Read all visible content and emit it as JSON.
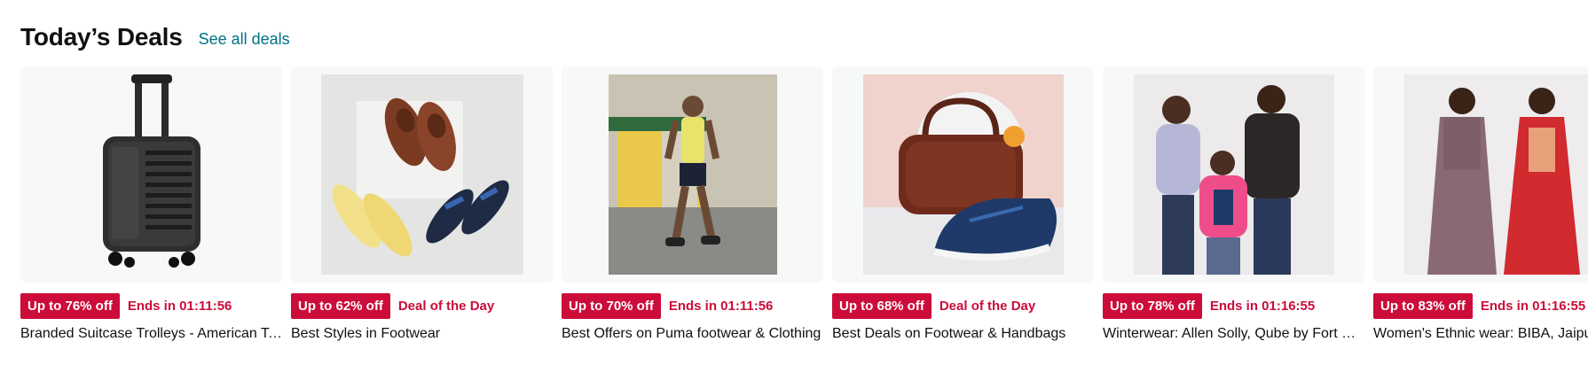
{
  "section": {
    "title": "Today’s Deals",
    "see_all_label": "See all deals"
  },
  "deals": [
    {
      "discount": "Up to 76% off",
      "status": "Ends in 01:11:56",
      "caption": "Branded Suitcase Trolleys - American Tourister, Safari, VIP & more",
      "image": "black-suitcase-trolley-icon"
    },
    {
      "discount": "Up to 62% off",
      "status": "Deal of the Day",
      "caption": "Best Styles in Footwear",
      "image": "footwear-shoes-sandals-icon"
    },
    {
      "discount": "Up to 70% off",
      "status": "Ends in 01:11:56",
      "caption": "Best Offers on Puma footwear & Clothing",
      "image": "athlete-walking-photo-icon"
    },
    {
      "discount": "Up to 68% off",
      "status": "Deal of the Day",
      "caption": "Best Deals on Footwear & Handbags",
      "image": "handbag-and-sneaker-icon"
    },
    {
      "discount": "Up to 78% off",
      "status": "Ends in 01:16:55",
      "caption": "Winterwear: Allen Solly, Qube by Fort Collins & more",
      "image": "family-winterwear-photo-icon"
    },
    {
      "discount": "Up to 83% off",
      "status": "Ends in 01:16:55",
      "caption": "Women's Ethnic wear: BIBA, Jaipur Kurti & more",
      "image": "ethnic-wear-women-photo-icon"
    }
  ],
  "colors": {
    "badge": "#cc0c39",
    "link": "#007185",
    "card_bg": "#f7f8f8"
  }
}
